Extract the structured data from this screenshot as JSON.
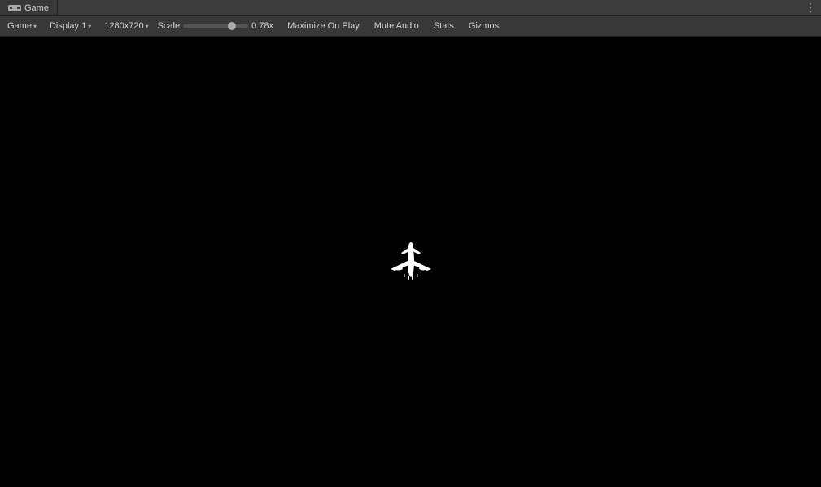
{
  "window": {
    "title": "Game",
    "more_icon": "⋮"
  },
  "toolbar": {
    "game_label": "Game",
    "display_label": "Display 1",
    "resolution_label": "1280x720",
    "scale_label": "Scale",
    "scale_value": "0.78x",
    "scale_slider_value": 0.78,
    "maximize_label": "Maximize On Play",
    "mute_label": "Mute Audio",
    "stats_label": "Stats",
    "gizmos_label": "Gizmos"
  },
  "viewport": {
    "background": "#000000"
  },
  "icons": {
    "dropdown_arrow": "▾",
    "tab_icon": "🎮",
    "vr_icon": "⊕"
  }
}
